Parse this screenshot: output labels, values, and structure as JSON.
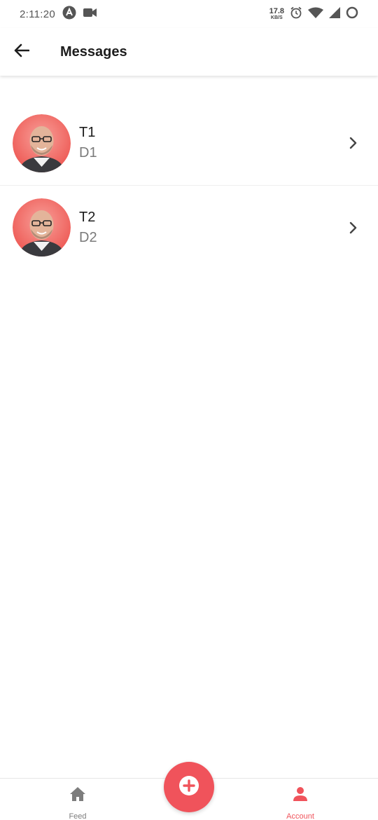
{
  "status_bar": {
    "time": "2:11:20",
    "net_speed_value": "17.8",
    "net_speed_unit": "KB/S"
  },
  "app_bar": {
    "title": "Messages"
  },
  "messages": [
    {
      "title": "T1",
      "description": "D1"
    },
    {
      "title": "T2",
      "description": "D2"
    }
  ],
  "bottom_nav": {
    "feed_label": "Feed",
    "account_label": "Account",
    "active": "Account"
  },
  "colors": {
    "accent": "#f0535b",
    "inactive": "#7d7d7d",
    "avatar_bg": "#f06560"
  }
}
